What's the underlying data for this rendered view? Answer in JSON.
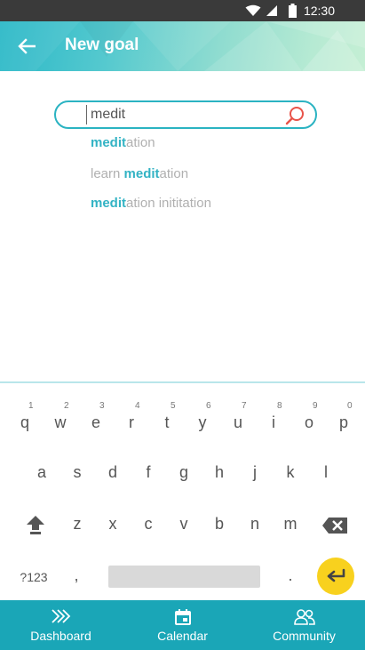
{
  "status_bar": {
    "time": "12:30",
    "icons": [
      "wifi-icon",
      "signal-icon",
      "battery-icon"
    ]
  },
  "app_bar": {
    "title": "New goal",
    "back_icon": "arrow-left-icon"
  },
  "search": {
    "value": "medit",
    "placeholder": ""
  },
  "suggestions": [
    {
      "pre": "",
      "match": "medit",
      "post": "ation"
    },
    {
      "pre": "learn ",
      "match": "medit",
      "post": "ation"
    },
    {
      "pre": "",
      "match": "medit",
      "post": "ation inititation"
    }
  ],
  "keyboard": {
    "row1": [
      {
        "key": "q",
        "hint": "1"
      },
      {
        "key": "w",
        "hint": "2"
      },
      {
        "key": "e",
        "hint": "3"
      },
      {
        "key": "r",
        "hint": "4"
      },
      {
        "key": "t",
        "hint": "5"
      },
      {
        "key": "y",
        "hint": "6"
      },
      {
        "key": "u",
        "hint": "7"
      },
      {
        "key": "i",
        "hint": "8"
      },
      {
        "key": "o",
        "hint": "9"
      },
      {
        "key": "p",
        "hint": "0"
      }
    ],
    "row2": [
      "a",
      "s",
      "d",
      "f",
      "g",
      "h",
      "j",
      "k",
      "l"
    ],
    "row3": [
      "z",
      "x",
      "c",
      "v",
      "b",
      "n",
      "m"
    ],
    "symbols_label": "?123",
    "comma": ",",
    "period": "."
  },
  "bottom_nav": {
    "items": [
      {
        "label": "Dashboard",
        "icon": "dashboard-icon"
      },
      {
        "label": "Calendar",
        "icon": "calendar-icon"
      },
      {
        "label": "Community",
        "icon": "community-icon"
      }
    ]
  },
  "colors": {
    "accent": "#1aa6b7",
    "highlight": "#33b3c4",
    "enter": "#f8d11e",
    "search_icon": "#e8544a"
  }
}
